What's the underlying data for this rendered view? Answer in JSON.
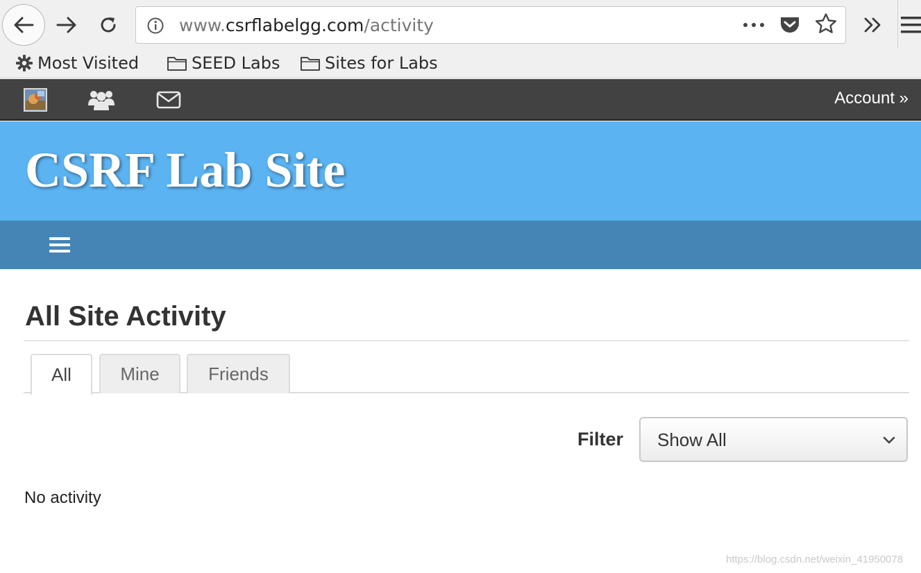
{
  "browser": {
    "url": {
      "prefix": "www.",
      "host": "csrflabelgg.com",
      "path": "/activity"
    },
    "bookmarks": [
      {
        "label": "Most Visited",
        "icon": "gear-icon"
      },
      {
        "label": "SEED Labs",
        "icon": "folder-icon"
      },
      {
        "label": "Sites for Labs",
        "icon": "folder-icon"
      }
    ]
  },
  "topbar": {
    "account_label": "Account »"
  },
  "site": {
    "title": "CSRF Lab Site"
  },
  "main": {
    "heading": "All Site Activity",
    "tabs": [
      {
        "label": "All",
        "active": true
      },
      {
        "label": "Mine",
        "active": false
      },
      {
        "label": "Friends",
        "active": false
      }
    ],
    "filter": {
      "label": "Filter",
      "selected": "Show All"
    },
    "empty_message": "No activity"
  },
  "watermark": "https://blog.csdn.net/weixin_41950078",
  "colors": {
    "header_bg": "#5bb3f2",
    "nav_bg": "#4585b6",
    "topbar_bg": "#424242"
  }
}
